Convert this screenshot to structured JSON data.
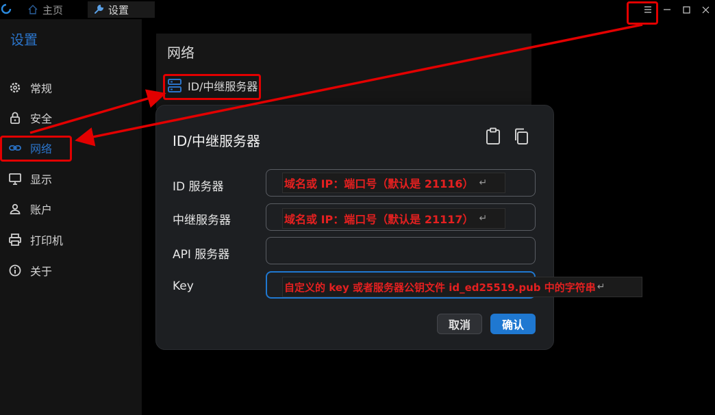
{
  "titlebar": {
    "tabs": [
      {
        "label": "主页",
        "icon": "home-icon"
      },
      {
        "label": "设置",
        "icon": "wrench-icon"
      }
    ],
    "controls": [
      "menu-icon",
      "minimize-icon",
      "maximize-icon",
      "close-icon"
    ]
  },
  "sidebar": {
    "title": "设置",
    "items": [
      {
        "label": "常规",
        "icon": "gear-icon"
      },
      {
        "label": "安全",
        "icon": "lock-icon"
      },
      {
        "label": "网络",
        "icon": "link-icon",
        "active": true
      },
      {
        "label": "显示",
        "icon": "monitor-icon"
      },
      {
        "label": "账户",
        "icon": "user-icon"
      },
      {
        "label": "打印机",
        "icon": "printer-icon"
      },
      {
        "label": "关于",
        "icon": "info-icon"
      }
    ]
  },
  "main": {
    "card_title": "网络",
    "server_link": "ID/中继服务器"
  },
  "dialog": {
    "title": "ID/中继服务器",
    "fields": [
      {
        "label": "ID 服务器",
        "hint": "域名或 IP：端口号（默认是 21116）",
        "value": ""
      },
      {
        "label": "中继服务器",
        "hint": "域名或 IP：端口号（默认是 21117）",
        "value": ""
      },
      {
        "label": "API 服务器",
        "value": ""
      },
      {
        "label": "Key",
        "hint": "自定义的 key 或者服务器公钥文件 id_ed25519.pub 中的字符串",
        "value": ""
      }
    ],
    "return_symbol": "↵",
    "cancel_label": "取消",
    "ok_label": "确认"
  },
  "colors": {
    "accent": "#2b74c9",
    "primary_button": "#1f78d1",
    "annotation": "#e20000"
  }
}
